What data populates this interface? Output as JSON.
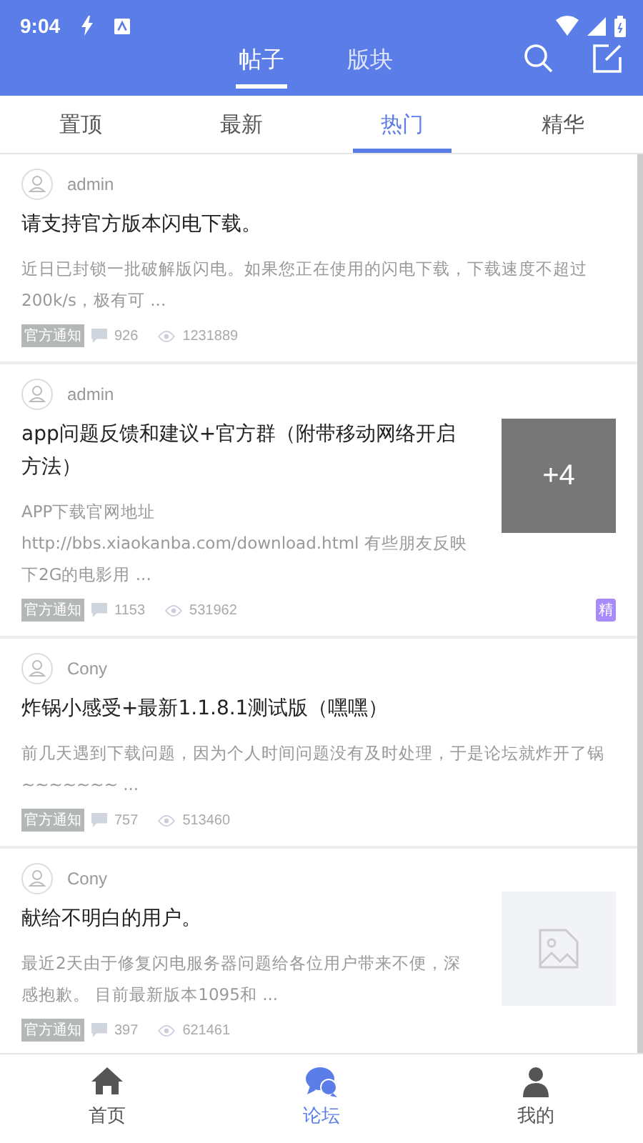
{
  "status_bar": {
    "time": "9:04"
  },
  "header": {
    "tabs": [
      {
        "label": "帖子",
        "selected": true
      },
      {
        "label": "版块",
        "selected": false
      }
    ]
  },
  "filter_tabs": [
    {
      "label": "置顶",
      "selected": false
    },
    {
      "label": "最新",
      "selected": false
    },
    {
      "label": "热门",
      "selected": true
    },
    {
      "label": "精华",
      "selected": false
    }
  ],
  "posts": [
    {
      "author": "admin",
      "title": "请支持官方版本闪电下载。",
      "excerpt": "近日已封锁一批破解版闪电。如果您正在使用的闪电下载，下载速度不超过200k/s，极有可 ...",
      "tag": "官方通知",
      "comments": "926",
      "views": "1231889"
    },
    {
      "author": "admin",
      "title": "app问题反馈和建议+官方群（附带移动网络开启方法）",
      "excerpt": "APP下载官网地址 http://bbs.xiaokanba.com/download.html 有些朋友反映下2G的电影用 ...",
      "tag": "官方通知",
      "comments": "1153",
      "views": "531962",
      "thumbnail": {
        "kind": "more",
        "label": "+4"
      },
      "badge": "精"
    },
    {
      "author": "Cony",
      "title": "炸锅小感受+最新1.1.8.1测试版（嘿嘿）",
      "excerpt": "前几天遇到下载问题，因为个人时间问题没有及时处理，于是论坛就炸开了锅~~~~~~~ ...",
      "tag": "官方通知",
      "comments": "757",
      "views": "513460"
    },
    {
      "author": "Cony",
      "title": "献给不明白的用户。",
      "excerpt": "最近2天由于修复闪电服务器问题给各位用户带来不便，深感抱歉。 目前最新版本1095和 ...",
      "tag": "官方通知",
      "comments": "397",
      "views": "621461",
      "thumbnail": {
        "kind": "placeholder"
      }
    }
  ],
  "bottom_nav": [
    {
      "label": "首页",
      "kind": "home",
      "selected": false
    },
    {
      "label": "论坛",
      "kind": "forum",
      "selected": true
    },
    {
      "label": "我的",
      "kind": "profile",
      "selected": false
    }
  ]
}
